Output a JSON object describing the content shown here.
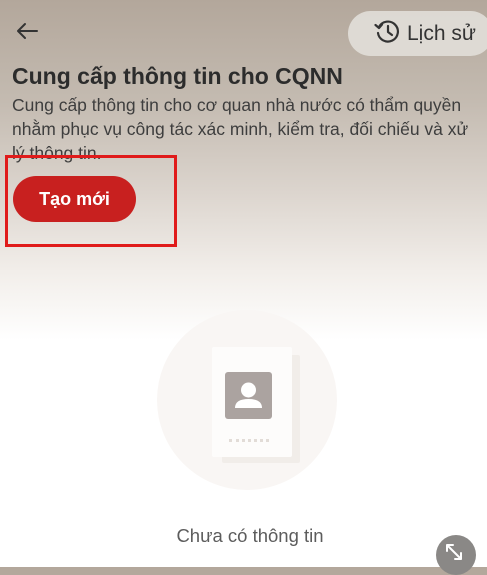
{
  "header": {
    "back_icon": "arrow-left-icon",
    "history_icon": "clock-history-icon",
    "history_label": "Lịch sử"
  },
  "main": {
    "title": "Cung cấp thông tin cho CQNN",
    "description": "Cung cấp thông tin cho cơ quan nhà nước có thẩm quyền nhằm phục vụ công tác xác minh, kiểm tra, đối chiếu và xử lý thông tin.",
    "create_button_label": "Tạo mới"
  },
  "empty_state": {
    "icon": "document-person-icon",
    "text": "Chưa có thông tin"
  },
  "overlay": {
    "expand_icon": "expand-arrows-icon"
  },
  "colors": {
    "accent": "#c8201f",
    "highlight_border": "#e01b1b"
  }
}
